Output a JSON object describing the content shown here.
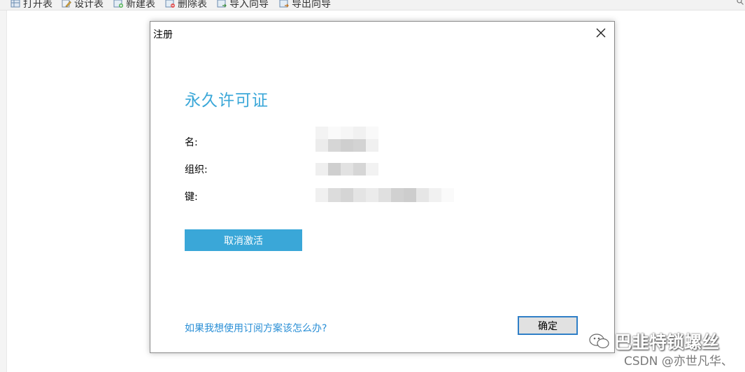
{
  "toolbar": {
    "items": [
      {
        "label": "打开表",
        "icon": "open-table-icon"
      },
      {
        "label": "设计表",
        "icon": "design-table-icon"
      },
      {
        "label": "新建表",
        "icon": "new-table-icon"
      },
      {
        "label": "删除表",
        "icon": "delete-table-icon"
      },
      {
        "label": "导入向导",
        "icon": "import-wizard-icon"
      },
      {
        "label": "导出向导",
        "icon": "export-wizard-icon"
      }
    ],
    "search_icon": "search-icon"
  },
  "dialog": {
    "title": "注册",
    "heading": "永久许可证",
    "fields": [
      {
        "label": "名:"
      },
      {
        "label": "组织:"
      },
      {
        "label": "键:"
      }
    ],
    "deactivate_label": "取消激活",
    "subscription_link": "如果我想使用订阅方案该怎么办?",
    "ok_label": "确定"
  },
  "watermark": {
    "wechat_name": "巴韭特锁螺丝",
    "csdn": "CSDN @亦世凡华、"
  },
  "colors": {
    "accent": "#3aa7d8",
    "link": "#2a8fd6",
    "ok_border": "#2f7fc7"
  }
}
